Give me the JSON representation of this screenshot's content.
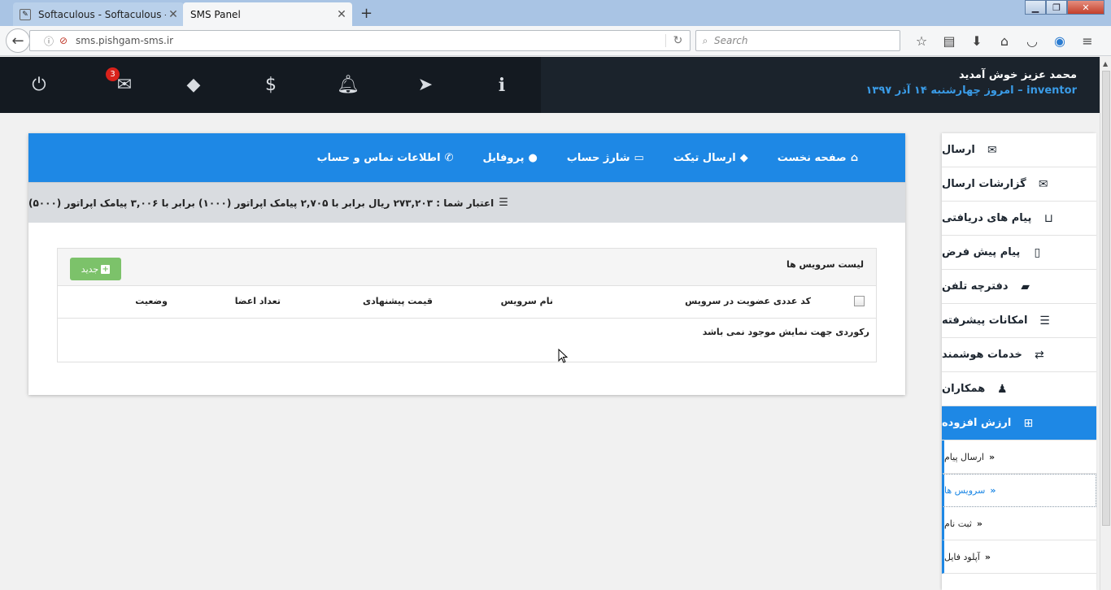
{
  "browser": {
    "tabs": [
      {
        "title": "Softaculous - Softaculous - P",
        "close": "✕"
      },
      {
        "title": "SMS Panel",
        "close": "✕"
      }
    ],
    "new_tab": "+",
    "url": "sms.pishgam-sms.ir",
    "search_placeholder": "Search"
  },
  "header": {
    "welcome": "محمد عزیز خوش آمدید",
    "username": "inventor",
    "date_text": "– امروز چهارشنبه ۱۴ آذر ۱۳۹۷",
    "mail_badge": "3",
    "icons": [
      "power-icon",
      "mail-icon",
      "ticket-icon",
      "dollar-icon",
      "bell-icon",
      "send-icon",
      "info-icon"
    ]
  },
  "topnav": {
    "items": [
      {
        "label": "صفحه نخست",
        "icon": "home-icon"
      },
      {
        "label": "ارسال تیکت",
        "icon": "ticket-icon"
      },
      {
        "label": "شارژ حساب",
        "icon": "credit-card-icon"
      },
      {
        "label": "پروفایل",
        "icon": "user-icon"
      },
      {
        "label": "اطلاعات تماس و حساب",
        "icon": "phone-icon"
      }
    ]
  },
  "credit": {
    "text": "اعتبار شما : ۲۷۳,۲۰۳ ریال برابر با ۲,۷۰۵ پیامک اپراتور (۱۰۰۰) برابر با ۳,۰۰۶ پیامک اپراتور (۵۰۰۰)"
  },
  "services": {
    "title": "لیست سرویس ها",
    "new_button": "جدید",
    "columns": [
      "کد عددی عضویت در سرویس",
      "نام سرویس",
      "قیمت پیشنهادی",
      "تعداد اعضا",
      "وضعیت"
    ],
    "empty_message": "رکوردی جهت نمایش موجود نمی باشد"
  },
  "sidebar": {
    "items": [
      {
        "label": "ارسال",
        "icon": "envelope-icon"
      },
      {
        "label": "گزارشات ارسال",
        "icon": "envelope-outline-icon"
      },
      {
        "label": "پیام های دریافتی",
        "icon": "inbox-icon"
      },
      {
        "label": "پیام پیش فرض",
        "icon": "tablet-icon"
      },
      {
        "label": "دفترچه تلفن",
        "icon": "book-icon"
      },
      {
        "label": "امکانات پیشرفته",
        "icon": "list-icon"
      },
      {
        "label": "خدمات هوشمند",
        "icon": "retweet-icon"
      },
      {
        "label": "همکاران",
        "icon": "users-icon"
      },
      {
        "label": "ارزش افزوده",
        "icon": "plus-square-icon"
      }
    ],
    "subitems": [
      {
        "label": "ارسال پیام"
      },
      {
        "label": "سرویس ها"
      },
      {
        "label": "ثبت نام"
      },
      {
        "label": "آپلود فایل"
      }
    ]
  }
}
